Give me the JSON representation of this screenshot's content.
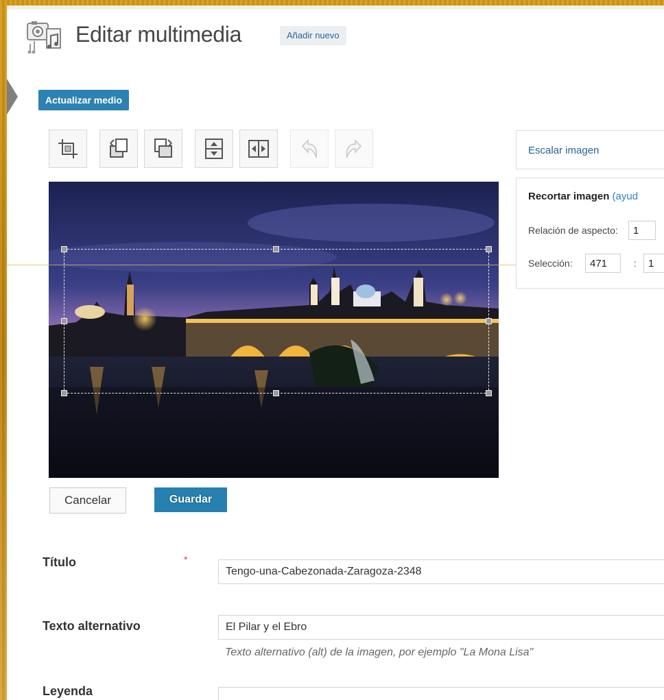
{
  "header": {
    "title": "Editar multimedia",
    "add_new": "Añadir nuevo"
  },
  "actions": {
    "update": "Actualizar medio",
    "cancel": "Cancelar",
    "save": "Guardar"
  },
  "toolbar": {
    "tools": [
      {
        "name": "crop-icon",
        "enabled": true
      },
      {
        "name": "rotate-left-icon",
        "enabled": true
      },
      {
        "name": "rotate-right-icon",
        "enabled": true
      },
      {
        "name": "flip-vertical-icon",
        "enabled": true
      },
      {
        "name": "flip-horizontal-icon",
        "enabled": true
      },
      {
        "name": "undo-icon",
        "enabled": false
      },
      {
        "name": "redo-icon",
        "enabled": false
      }
    ]
  },
  "side": {
    "scale_label": "Escalar imagen",
    "crop_label": "Recortar imagen",
    "crop_help": "(ayud",
    "aspect_label": "Relación de aspecto:",
    "aspect_value": "1",
    "selection_label": "Selección:",
    "selection_width": "471",
    "selection_sep": ":",
    "selection_height": "1"
  },
  "fields": {
    "title_label": "Título",
    "title_required": "*",
    "title_value": "Tengo-una-Cabezonada-Zaragoza-2348",
    "alt_label": "Texto alternativo",
    "alt_value": "El Pilar y el Ebro",
    "alt_hint": "Texto alternativo (alt) de la imagen, por ejemplo \"La Mona Lisa\"",
    "caption_label": "Leyenda",
    "caption_value": ""
  },
  "colors": {
    "primary_button": "#2c82b2",
    "link": "#2a6496",
    "frame": "#c98f1a"
  }
}
